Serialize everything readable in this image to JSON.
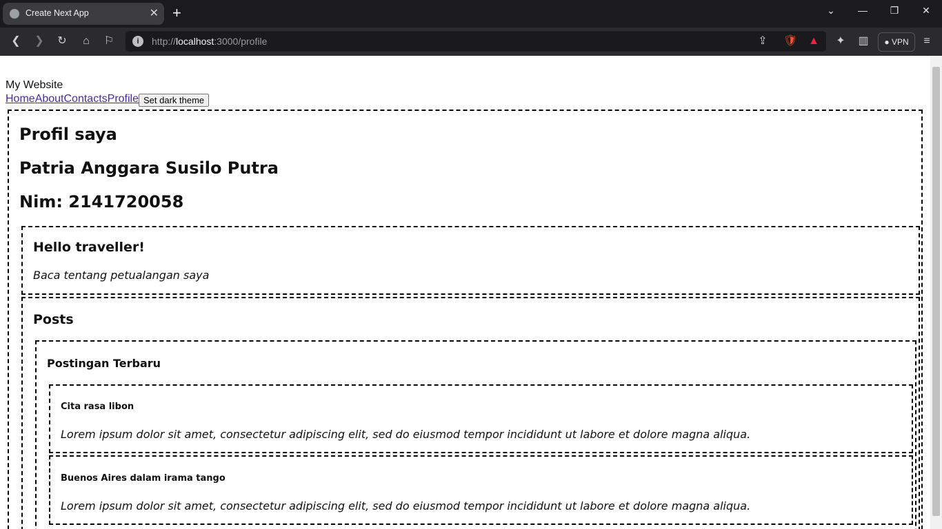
{
  "browser": {
    "tab_title": "Create Next App",
    "new_tab": "+",
    "url_scheme_host_prefix": "http://",
    "url_host": "localhost",
    "url_rest": ":3000/profile",
    "vpn_label": "VPN"
  },
  "page": {
    "site_title": "My Website",
    "nav": [
      "Home",
      "About",
      "Contacts",
      "Profile"
    ],
    "theme_button": "Set dark theme",
    "profile_heading": "Profil saya",
    "name": "Patria Anggara Susilo Putra",
    "nim": "Nim: 2141720058",
    "greeting_title": "Hello traveller!",
    "greeting_text": "Baca tentang petualangan saya",
    "posts_title": "Posts",
    "latest_title": "Postingan Terbaru",
    "posts": [
      {
        "title": "Cita rasa libon",
        "body": "Lorem ipsum dolor sit amet, consectetur adipiscing elit, sed do eiusmod tempor incididunt ut labore et dolore magna aliqua."
      },
      {
        "title": "Buenos Aires dalam irama tango",
        "body": "Lorem ipsum dolor sit amet, consectetur adipiscing elit, sed do eiusmod tempor incididunt ut labore et dolore magna aliqua."
      }
    ]
  },
  "icons": [
    "globe-icon",
    "close-icon",
    "plus-icon",
    "back-icon",
    "forward-icon",
    "reload-icon",
    "home-icon",
    "bookmark-icon",
    "info-icon",
    "share-icon",
    "brave-icon",
    "rewards-icon",
    "extensions-icon",
    "sidebar-icon",
    "menu-icon"
  ]
}
